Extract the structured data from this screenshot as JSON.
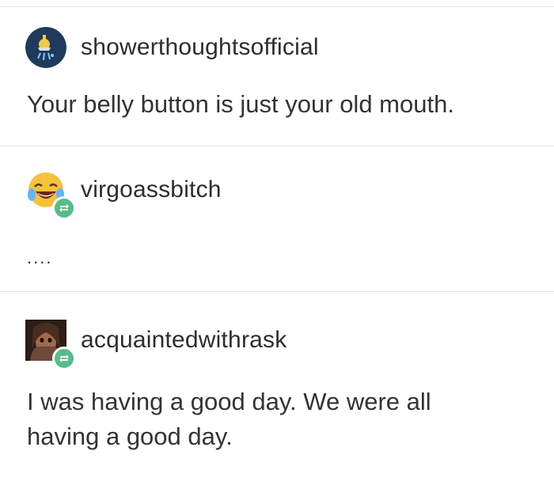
{
  "posts": [
    {
      "username": "showerthoughtsofficial",
      "avatar_icon": "shower-head-icon",
      "text": "Your belly button is just your old mouth."
    },
    {
      "username": "virgoassbitch",
      "avatar_icon": "laughing-crying-emoji-icon",
      "reblog_icon": "reblog-icon",
      "text": "...."
    },
    {
      "username": "acquaintedwithrask",
      "avatar_icon": "portrait-photo-icon",
      "reblog_icon": "reblog-icon",
      "text_line1": "I was having a good day. We were all",
      "text_line2": "having a good day."
    }
  ],
  "colors": {
    "reblog_badge": "#56bc8a",
    "divider": "#e3e3e3",
    "avatar1_bg": "#1f3a5c"
  }
}
